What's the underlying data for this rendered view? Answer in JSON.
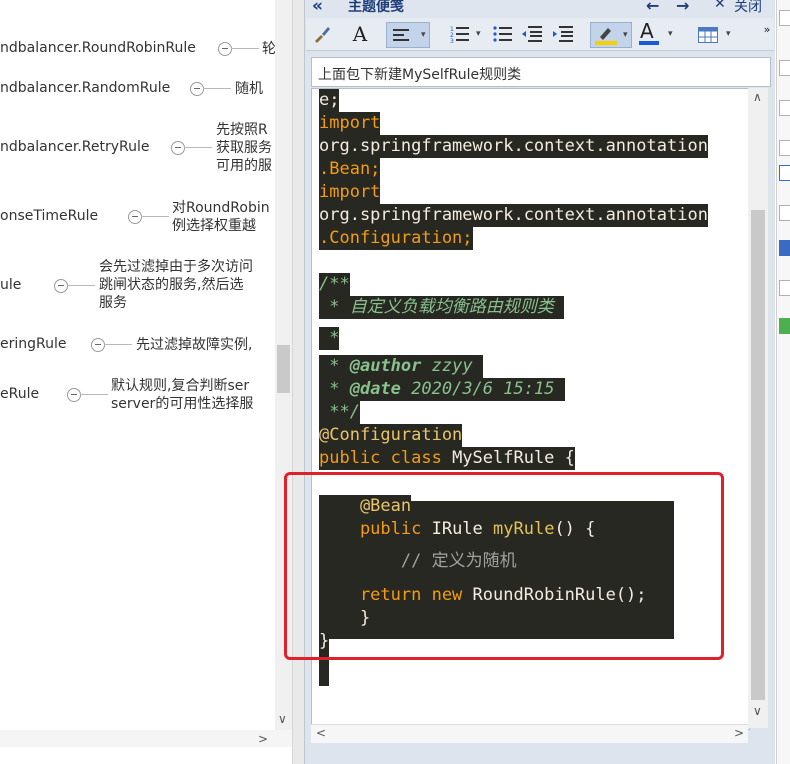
{
  "mindmap": {
    "rows": [
      {
        "name": "ndbalancer.RoundRobinRule",
        "desc": [
          "轮"
        ]
      },
      {
        "name": "ndbalancer.RandomRule",
        "desc": [
          "随机"
        ]
      },
      {
        "name": "ndbalancer.RetryRule",
        "desc": [
          "先按照R",
          "获取服务",
          "可用的服"
        ]
      },
      {
        "name": "onseTimeRule",
        "desc": [
          "对RoundRobin",
          "例选择权重越"
        ]
      },
      {
        "name": "ule",
        "desc": [
          "会先过滤掉由于多次访问",
          "跳闸状态的服务,然后选",
          "服务"
        ]
      },
      {
        "name": "eringRule",
        "desc": [
          "先过滤掉故障实例,"
        ]
      },
      {
        "name": "eRule",
        "desc": [
          "默认规则,复合判断ser",
          "server的可用性选择服"
        ]
      }
    ],
    "scroll_arrows": {
      "down": "∨",
      "right": ">"
    }
  },
  "panel": {
    "header_title": "主题便笺",
    "header_close": "关闭",
    "collapse_icon": "«",
    "nav_back_icon": "←",
    "nav_forward_icon": "→",
    "close_icon": "✕",
    "overflow_icon": "»",
    "toolbar": {
      "brush": "brush-icon",
      "font": "A",
      "align": "align-left-icon",
      "numbered_list": "numbered-list-icon",
      "bullet_list": "bullet-list-icon",
      "outdent": "outdent-icon",
      "indent": "indent-icon",
      "highlight": "highlighter-icon",
      "font_color": "A",
      "table": "table-icon"
    },
    "note_title": "上面包下新建MySelfRule规则类",
    "highlight_color": "#f5d000",
    "font_color_value": "#1a5ad6"
  },
  "code": {
    "lines": [
      [
        {
          "t": "e;",
          "c": "pl"
        }
      ],
      [
        {
          "t": "import",
          "c": "kw"
        }
      ],
      [
        {
          "t": "org.springframework.context.annotation",
          "c": "pl"
        }
      ],
      [
        {
          "t": ".Bean;",
          "c": "kw"
        }
      ],
      [
        {
          "t": "import",
          "c": "kw"
        }
      ],
      [
        {
          "t": "org.springframework.context.annotation",
          "c": "pl"
        }
      ],
      [
        {
          "t": ".Configuration;",
          "c": "kw"
        }
      ],
      [
        {
          "t": "/**",
          "c": "cm"
        }
      ],
      [
        {
          "t": " * 自定义负载均衡路由规则类 ",
          "c": "cm"
        }
      ],
      [
        {
          "t": " *",
          "c": "cm"
        }
      ],
      [
        {
          "t": " * ",
          "c": "cm"
        },
        {
          "t": "@author",
          "c": "cmb"
        },
        {
          "t": " zzyy ",
          "c": "cm"
        }
      ],
      [
        {
          "t": " * ",
          "c": "cm"
        },
        {
          "t": "@date",
          "c": "cmb"
        },
        {
          "t": " 2020/3/6 15:15 ",
          "c": "cm"
        }
      ],
      [
        {
          "t": " **/",
          "c": "cm"
        }
      ],
      [
        {
          "t": "@Configuration",
          "c": "an"
        }
      ],
      [
        {
          "t": "public class ",
          "c": "kw"
        },
        {
          "t": "MySelfRule {",
          "c": "pl"
        }
      ],
      [
        {
          "t": "    @Bean",
          "c": "an"
        }
      ],
      [
        {
          "t": "    public ",
          "c": "kw"
        },
        {
          "t": "IRule ",
          "c": "pl"
        },
        {
          "t": "myRule",
          "c": "fn"
        },
        {
          "t": "() {",
          "c": "pl"
        }
      ],
      [
        {
          "t": "        // 定义为随机",
          "c": "cmg"
        }
      ],
      [
        {
          "t": "    return new ",
          "c": "kw"
        },
        {
          "t": "RoundRobinRule();",
          "c": "pl"
        }
      ],
      [
        {
          "t": "    }",
          "c": "pl"
        }
      ],
      [
        {
          "t": "}",
          "c": "pl"
        }
      ]
    ]
  }
}
